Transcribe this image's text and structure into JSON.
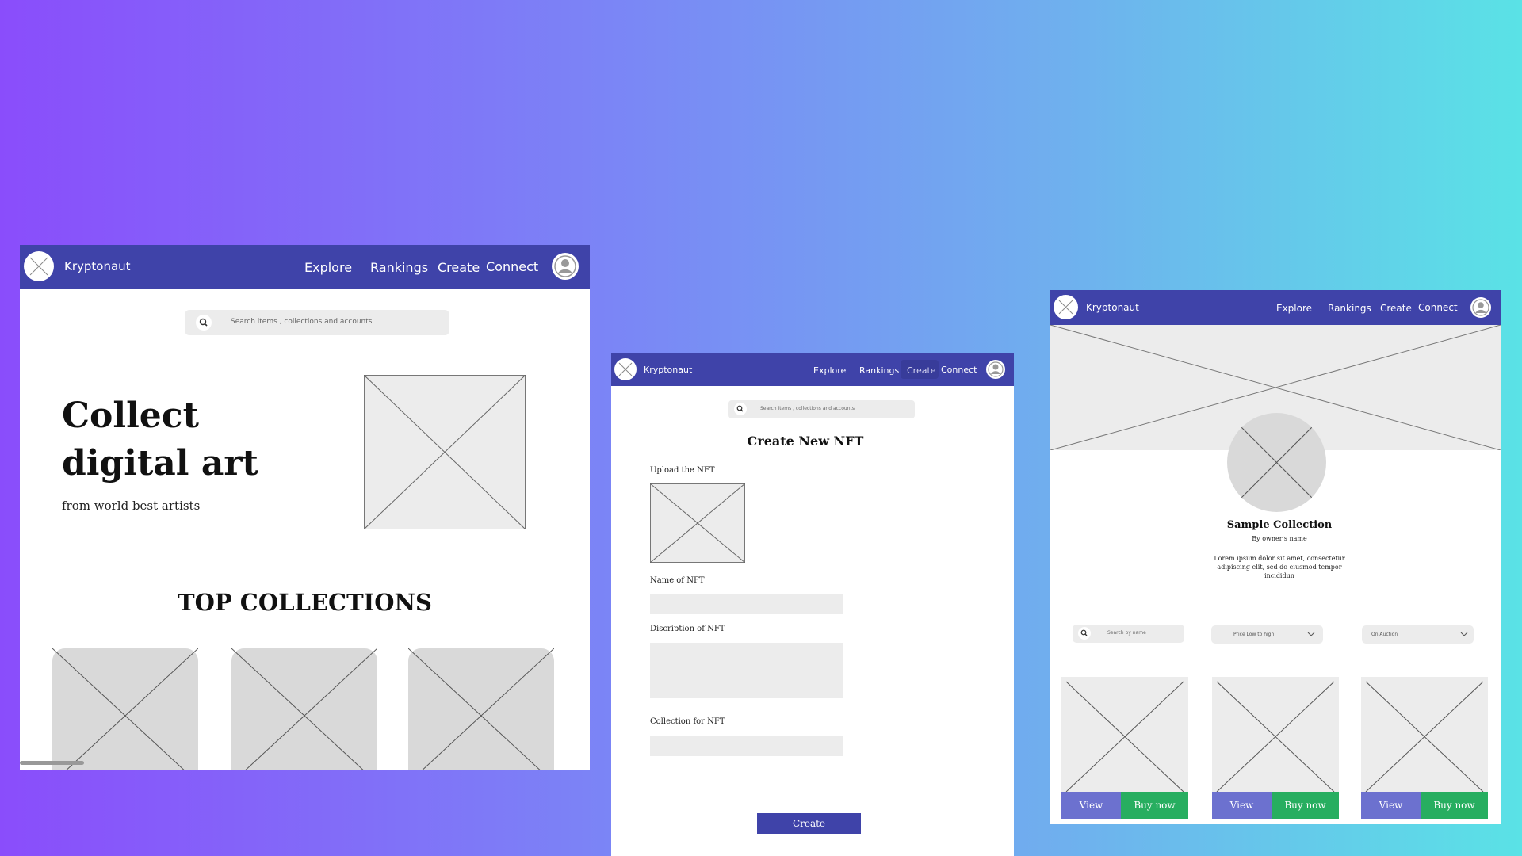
{
  "home": {
    "brand": "Kryptonaut",
    "nav": [
      "Explore",
      "Rankings",
      "Create",
      "Connect"
    ],
    "search_placeholder": "Search items , collections and accounts",
    "hero_title_line1": "Collect",
    "hero_title_line2": "digital art",
    "hero_subtitle": "from world best artists",
    "section_title": "TOP COLLECTIONS"
  },
  "create": {
    "brand": "Kryptonaut",
    "nav": [
      "Explore",
      "Rankings",
      "Create",
      "Connect"
    ],
    "search_placeholder": "Search items , collections and accounts",
    "title": "Create New NFT",
    "upload_label": "Upload the NFT",
    "name_label": "Name of NFT",
    "description_label": "Discription of NFT",
    "collection_label": "Collection for NFT",
    "submit_label": "Create"
  },
  "collection": {
    "brand": "Kryptonaut",
    "nav": [
      "Explore",
      "Rankings",
      "Create",
      "Connect"
    ],
    "name": "Sample Collection",
    "owner": "By owner's name",
    "description": "Lorem ipsum dolor sit amet, consectetur adipiscing elit, sed do eiusmod tempor incididun",
    "search_placeholder": "Search by name",
    "sort_value": "Price Low to high",
    "status_value": "On Auction",
    "cards": [
      {
        "view": "View",
        "buy": "Buy now"
      },
      {
        "view": "View",
        "buy": "Buy now"
      },
      {
        "view": "View",
        "buy": "Buy now"
      }
    ]
  },
  "colors": {
    "nav": "#3f43a9",
    "view_button": "#6c71cf",
    "buy_button": "#27ae60",
    "create_button": "#3f43a9",
    "placeholder": "#ececec"
  },
  "icons": [
    "logo-icon",
    "avatar-icon",
    "search-icon",
    "chevron-down-icon",
    "image-placeholder-icon"
  ]
}
